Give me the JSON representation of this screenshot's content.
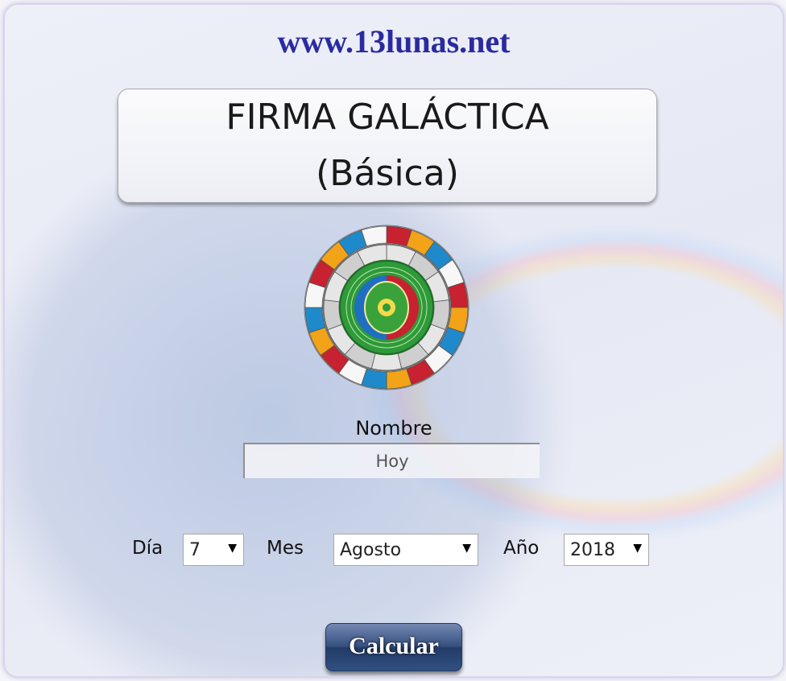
{
  "site": {
    "url": "www.13lunas.net"
  },
  "title": {
    "line1": "FIRMA GALÁCTICA",
    "line2": "(Básica)"
  },
  "logo": {
    "icon": "mayan-calendar-wheel-icon",
    "colors": [
      "#c8212f",
      "#f2a317",
      "#1f8acb",
      "#f7f7f7",
      "#3aa23a"
    ]
  },
  "form": {
    "name_label": "Nombre",
    "name_value": "Hoy",
    "day_label": "Día",
    "day_value": "7",
    "month_label": "Mes",
    "month_value": "Agosto",
    "year_label": "Año",
    "year_value": "2018",
    "submit_label": "Calcular"
  },
  "colors": {
    "url": "#2a2ba0",
    "button": "#35507f"
  }
}
